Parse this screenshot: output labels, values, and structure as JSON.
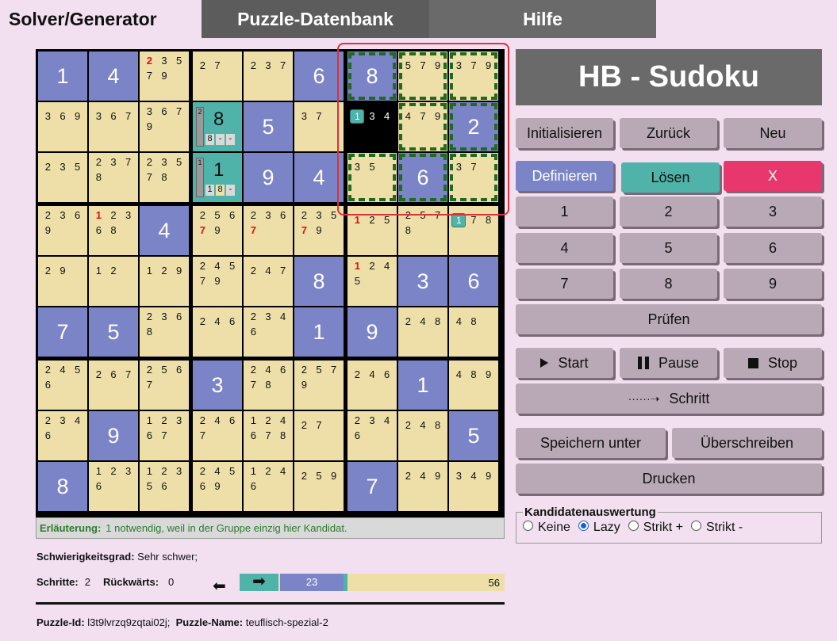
{
  "tabs": {
    "solver": "Solver/Generator",
    "db": "Puzzle-Datenbank",
    "help": "Hilfe"
  },
  "brand": "HB - Sudoku",
  "buttons": {
    "init": "Initialisieren",
    "back": "Zurück",
    "new": "Neu",
    "define": "Definieren",
    "solve": "Lösen",
    "clear": "X",
    "digits": [
      "1",
      "2",
      "3",
      "4",
      "5",
      "6",
      "7",
      "8",
      "9"
    ],
    "check": "Prüfen",
    "start": "Start",
    "pause": "Pause",
    "stop": "Stop",
    "step": "Schritt",
    "save_as": "Speichern unter",
    "overwrite": "Überschreiben",
    "print": "Drucken"
  },
  "kand": {
    "legend": "Kandidatenauswertung",
    "options": [
      "Keine",
      "Lazy",
      "Strikt +",
      "Strikt -"
    ],
    "selected": "Lazy"
  },
  "explain": {
    "label": "Erläuterung:",
    "text": "1 notwendig, weil in der Gruppe einzig hier Kandidat."
  },
  "difficulty": {
    "label": "Schwierigkeitsgrad:",
    "value": "Sehr schwer;"
  },
  "steps": {
    "label": "Schritte:",
    "value": "2",
    "back_label": "Rückwärts:",
    "back_value": "0"
  },
  "progress": {
    "current": "23",
    "total": "56",
    "fraction": 0.41
  },
  "puzzle": {
    "id_label": "Puzzle-Id:",
    "id": "l3t9lvrzq9zqtai02j;",
    "name_label": "Puzzle-Name:",
    "name": "teuflisch-spezial-2"
  },
  "grid": {
    "cells": [
      [
        {
          "v": "1"
        },
        {
          "v": "4"
        },
        {
          "c": [
            "2",
            "3",
            "5",
            "7",
            "9"
          ],
          "r": [
            "2"
          ]
        },
        {
          "c": [
            "2",
            "7"
          ],
          "two": true
        },
        {
          "c": [
            "2",
            "3",
            "7"
          ],
          "two": true
        },
        {
          "v": "6"
        },
        {
          "v": "8"
        },
        {
          "c": [
            "5",
            "7",
            "9"
          ],
          "two": true
        },
        {
          "c": [
            "3",
            "7",
            "9"
          ],
          "two": true
        }
      ],
      [
        {
          "c": [
            "3",
            "6",
            "9"
          ],
          "two": true
        },
        {
          "c": [
            "3",
            "6",
            "7"
          ],
          "two": true
        },
        {
          "c": [
            "3",
            "6",
            "7",
            "9"
          ]
        },
        {
          "special": "8"
        },
        {
          "v": "5"
        },
        {
          "c": [
            "3",
            "7"
          ],
          "two": true
        },
        {
          "c": [
            "1",
            "3",
            "4"
          ],
          "two": true,
          "sel": true,
          "tag": "1"
        },
        {
          "c": [
            "4",
            "7",
            "9"
          ],
          "two": true
        },
        {
          "v": "2"
        }
      ],
      [
        {
          "c": [
            "2",
            "3",
            "5"
          ],
          "two": true
        },
        {
          "c": [
            "2",
            "3",
            "7",
            "8"
          ]
        },
        {
          "c": [
            "2",
            "3",
            "5",
            "7",
            "8"
          ]
        },
        {
          "special": "1"
        },
        {
          "v": "9"
        },
        {
          "v": "4"
        },
        {
          "c": [
            "3",
            "5"
          ],
          "two": true
        },
        {
          "v": "6"
        },
        {
          "c": [
            "3",
            "7"
          ],
          "two": true
        }
      ],
      [
        {
          "c": [
            "2",
            "3",
            "6",
            "9"
          ]
        },
        {
          "c": [
            "1",
            "2",
            "3",
            "6",
            "8"
          ],
          "r": [
            "1"
          ]
        },
        {
          "v": "4"
        },
        {
          "c": [
            "2",
            "5",
            "6",
            "7",
            "9"
          ],
          "r": [
            "7"
          ]
        },
        {
          "c": [
            "2",
            "3",
            "6",
            "7"
          ],
          "r": [
            "7"
          ]
        },
        {
          "c": [
            "2",
            "3",
            "5",
            "7",
            "9"
          ],
          "r": [
            "7"
          ]
        },
        {
          "c": [
            "1",
            "2",
            "5"
          ],
          "r": [
            "1"
          ],
          "two": true
        },
        {
          "c": [
            "2",
            "5",
            "7",
            "8"
          ]
        },
        {
          "c": [
            "1",
            "7",
            "8"
          ],
          "two": true,
          "tag": "1"
        }
      ],
      [
        {
          "c": [
            "2",
            "9"
          ],
          "two": true
        },
        {
          "c": [
            "1",
            "2"
          ],
          "two": true
        },
        {
          "c": [
            "1",
            "2",
            "9"
          ],
          "two": true
        },
        {
          "c": [
            "2",
            "4",
            "5",
            "7",
            "9"
          ]
        },
        {
          "c": [
            "2",
            "4",
            "7"
          ],
          "two": true
        },
        {
          "v": "8"
        },
        {
          "c": [
            "1",
            "2",
            "4",
            "5"
          ],
          "r": [
            "1"
          ]
        },
        {
          "v": "3"
        },
        {
          "v": "6"
        }
      ],
      [
        {
          "v": "7"
        },
        {
          "v": "5"
        },
        {
          "c": [
            "2",
            "3",
            "6",
            "8"
          ]
        },
        {
          "c": [
            "2",
            "4",
            "6"
          ],
          "two": true
        },
        {
          "c": [
            "2",
            "3",
            "4",
            "6"
          ]
        },
        {
          "v": "1"
        },
        {
          "v": "9"
        },
        {
          "c": [
            "2",
            "4",
            "8"
          ],
          "two": true
        },
        {
          "c": [
            "4",
            "8"
          ],
          "two": true
        }
      ],
      [
        {
          "c": [
            "2",
            "4",
            "5",
            "6"
          ]
        },
        {
          "c": [
            "2",
            "6",
            "7"
          ],
          "two": true
        },
        {
          "c": [
            "2",
            "5",
            "6",
            "7"
          ]
        },
        {
          "v": "3"
        },
        {
          "c": [
            "2",
            "4",
            "6",
            "7",
            "8"
          ]
        },
        {
          "c": [
            "2",
            "5",
            "7",
            "9"
          ]
        },
        {
          "c": [
            "2",
            "4",
            "6"
          ],
          "two": true
        },
        {
          "v": "1"
        },
        {
          "c": [
            "4",
            "8",
            "9"
          ],
          "two": true
        }
      ],
      [
        {
          "c": [
            "2",
            "3",
            "4",
            "6"
          ]
        },
        {
          "v": "9"
        },
        {
          "c": [
            "1",
            "2",
            "3",
            "6",
            "7"
          ]
        },
        {
          "c": [
            "2",
            "4",
            "6",
            "7"
          ]
        },
        {
          "c": [
            "1",
            "2",
            "4",
            "6",
            "7",
            "8"
          ]
        },
        {
          "c": [
            "2",
            "7"
          ],
          "two": true
        },
        {
          "c": [
            "2",
            "3",
            "4",
            "6"
          ]
        },
        {
          "c": [
            "2",
            "4",
            "8"
          ],
          "two": true
        },
        {
          "v": "5"
        }
      ],
      [
        {
          "v": "8"
        },
        {
          "c": [
            "1",
            "2",
            "3",
            "6"
          ]
        },
        {
          "c": [
            "1",
            "2",
            "3",
            "5",
            "6"
          ]
        },
        {
          "c": [
            "2",
            "4",
            "5",
            "6",
            "9"
          ]
        },
        {
          "c": [
            "1",
            "2",
            "4",
            "6"
          ]
        },
        {
          "c": [
            "2",
            "5",
            "9"
          ],
          "two": true
        },
        {
          "v": "7"
        },
        {
          "c": [
            "2",
            "4",
            "9"
          ],
          "two": true
        },
        {
          "c": [
            "3",
            "4",
            "9"
          ],
          "two": true
        }
      ]
    ]
  },
  "colors": {
    "given": "#7b84c6",
    "empty": "#eedfa9",
    "teal": "#4fb3a9",
    "red": "#e8376d",
    "accent": "#1f6a1f"
  }
}
